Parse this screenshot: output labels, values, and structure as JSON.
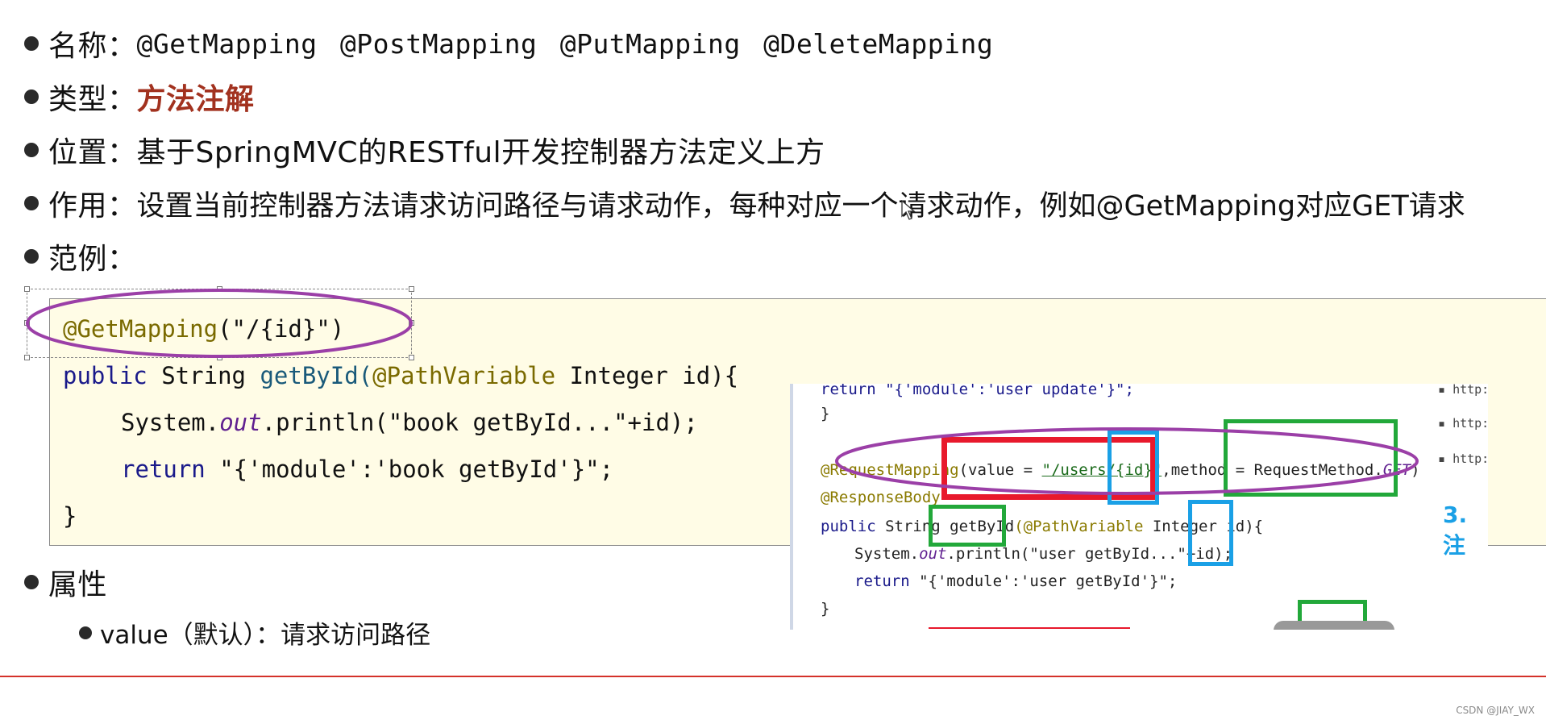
{
  "bullets": {
    "name_label": "名称：",
    "name_value": "@GetMapping  @PostMapping  @PutMapping  @DeleteMapping",
    "type_label": "类型：",
    "type_value": "方法注解",
    "position_label": "位置：",
    "position_value": "基于SpringMVC的RESTful开发控制器方法定义上方",
    "effect_label": "作用：",
    "effect_value": "设置当前控制器方法请求访问路径与请求动作，每种对应一个请求动作，例如@GetMapping对应GET请求",
    "example_label": "范例：",
    "attributes_label": "属性"
  },
  "code": {
    "line1_annotation": "@GetMapping",
    "line1_args": "(\"/{id}\")",
    "line2_public": "public",
    "line2_type": " String ",
    "line2_method": "getById(",
    "line2_anno": "@PathVariable",
    "line2_rest": " Integer id){",
    "line3_prefix": "System.",
    "line3_out": "out",
    "line3_rest": ".println(\"book getById...\"+id);",
    "line4_return": "return",
    "line4_rest": " \"{'module':'book getById'}\";",
    "line5": "}"
  },
  "overlay": {
    "line1": "return \"{'module':'user update'}\";",
    "line2": "}",
    "line3_anno": "@RequestMapping",
    "line3_a": "(value = ",
    "line3_str": "\"/users/{id}\"",
    "line3_b": ",method = RequestMethod.",
    "line3_get": "GET",
    "line3_c": ")",
    "line4": "@ResponseBody",
    "line5_public": "public",
    "line5_rest1": " String ",
    "line5_method": "getById",
    "line5_anno": "(@PathVariable",
    "line5_rest2": " Integer id){",
    "line6_a": "System.",
    "line6_out": "out",
    "line6_b": ".println(\"user getById...\"+id);",
    "line7_return": "return",
    "line7_rest": " \"{'module':'user getById'}\";",
    "line8": "}",
    "right_marks": [
      "http:/",
      "http:/",
      "http:/"
    ],
    "side_label": "3.注"
  },
  "sub_bullet": {
    "text": "value（默认）：请求访问路径"
  },
  "watermark": "CSDN @JIAY_WX",
  "colors": {
    "ellipse": "#9b3fa7",
    "red_box": "#e8192c",
    "blue_box": "#1aa0e6",
    "green_box": "#22a83a",
    "accent_red": "#a2321f",
    "footer_rule": "#d4322a"
  }
}
